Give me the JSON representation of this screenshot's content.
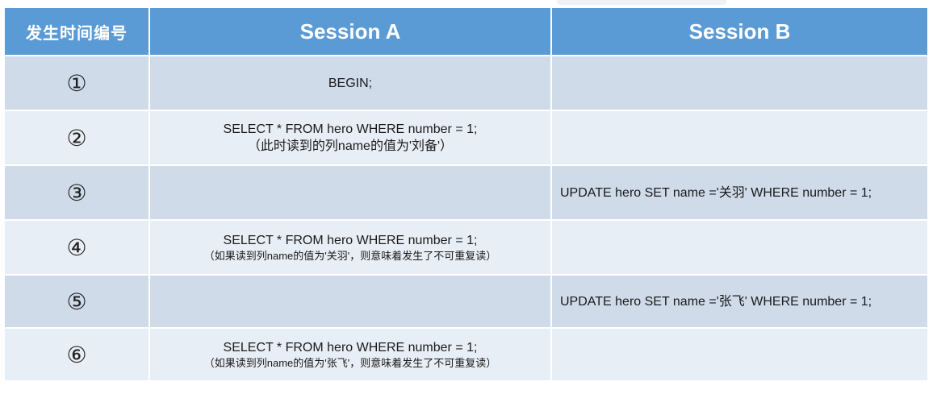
{
  "header": {
    "col_number": "发生时间编号",
    "col_a": "Session A",
    "col_b": "Session B"
  },
  "rows": [
    {
      "num": "①",
      "a1": "BEGIN;",
      "a2": "",
      "b": ""
    },
    {
      "num": "②",
      "a1": "SELECT * FROM hero WHERE number = 1;",
      "a2": "（此时读到的列name的值为'刘备'）",
      "b": ""
    },
    {
      "num": "③",
      "a1": "",
      "a2": "",
      "b": "UPDATE hero SET name ='关羽' WHERE number = 1;"
    },
    {
      "num": "④",
      "a1": "SELECT * FROM hero WHERE number = 1;",
      "a2": "（如果读到列name的值为'关羽'，则意味着发生了不可重复读）",
      "b": ""
    },
    {
      "num": "⑤",
      "a1": "",
      "a2": "",
      "b": "UPDATE hero SET name ='张飞' WHERE number = 1;"
    },
    {
      "num": "⑥",
      "a1": "SELECT * FROM hero WHERE number = 1;",
      "a2": "（如果读到列name的值为'张飞'，则意味着发生了不可重复读）",
      "b": ""
    }
  ],
  "colors": {
    "header_bg": "#5b9bd5",
    "row_dark": "#cfdbe9",
    "row_light": "#e8eef5"
  }
}
